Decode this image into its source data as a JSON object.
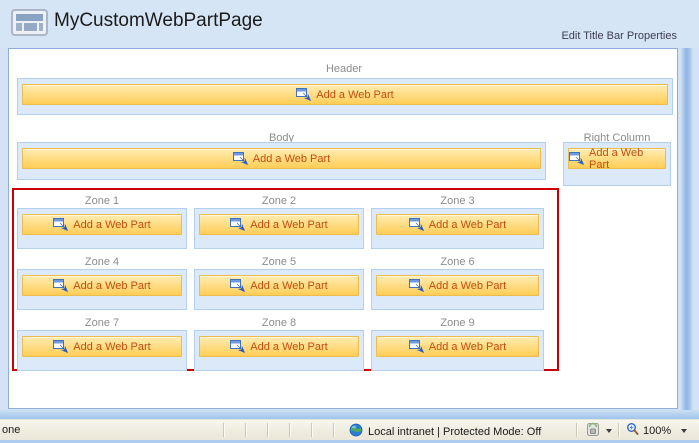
{
  "window": {
    "title": "MyCustomWebPartPage"
  },
  "header_bar": {
    "edit_link": "Edit Title Bar Properties"
  },
  "labels": {
    "add_web_part": "Add a Web Part"
  },
  "zones": {
    "header": {
      "label": "Header"
    },
    "body": {
      "label": "Body"
    },
    "right_column": {
      "label": "Right Column"
    },
    "custom": [
      {
        "label": "Zone 1"
      },
      {
        "label": "Zone 2"
      },
      {
        "label": "Zone 3"
      },
      {
        "label": "Zone 4"
      },
      {
        "label": "Zone 5"
      },
      {
        "label": "Zone 6"
      },
      {
        "label": "Zone 7"
      },
      {
        "label": "Zone 8"
      },
      {
        "label": "Zone 9"
      }
    ]
  },
  "status_bar": {
    "left_text": "one",
    "security_zone": "Local intranet | Protected Mode: Off",
    "zoom_level": "100%"
  },
  "icons": {
    "web-part-page-icon": "layout glyph",
    "add-web-part-icon": "window with blue arrow",
    "globe-icon": "blue-green globe",
    "privacy-filter-icon": "gray page filter",
    "zoom-icon": "blue magnifier",
    "dropdown-caret-icon": "black triangle"
  },
  "colors": {
    "highlight_border": "#CC0000",
    "button_text": "#C14F0E",
    "button_gold_top": "#FFEDB3",
    "button_gold_bottom": "#FFCE57",
    "zone_fill": "#DCE9F9",
    "frame_blue": "#D3E3F5"
  }
}
